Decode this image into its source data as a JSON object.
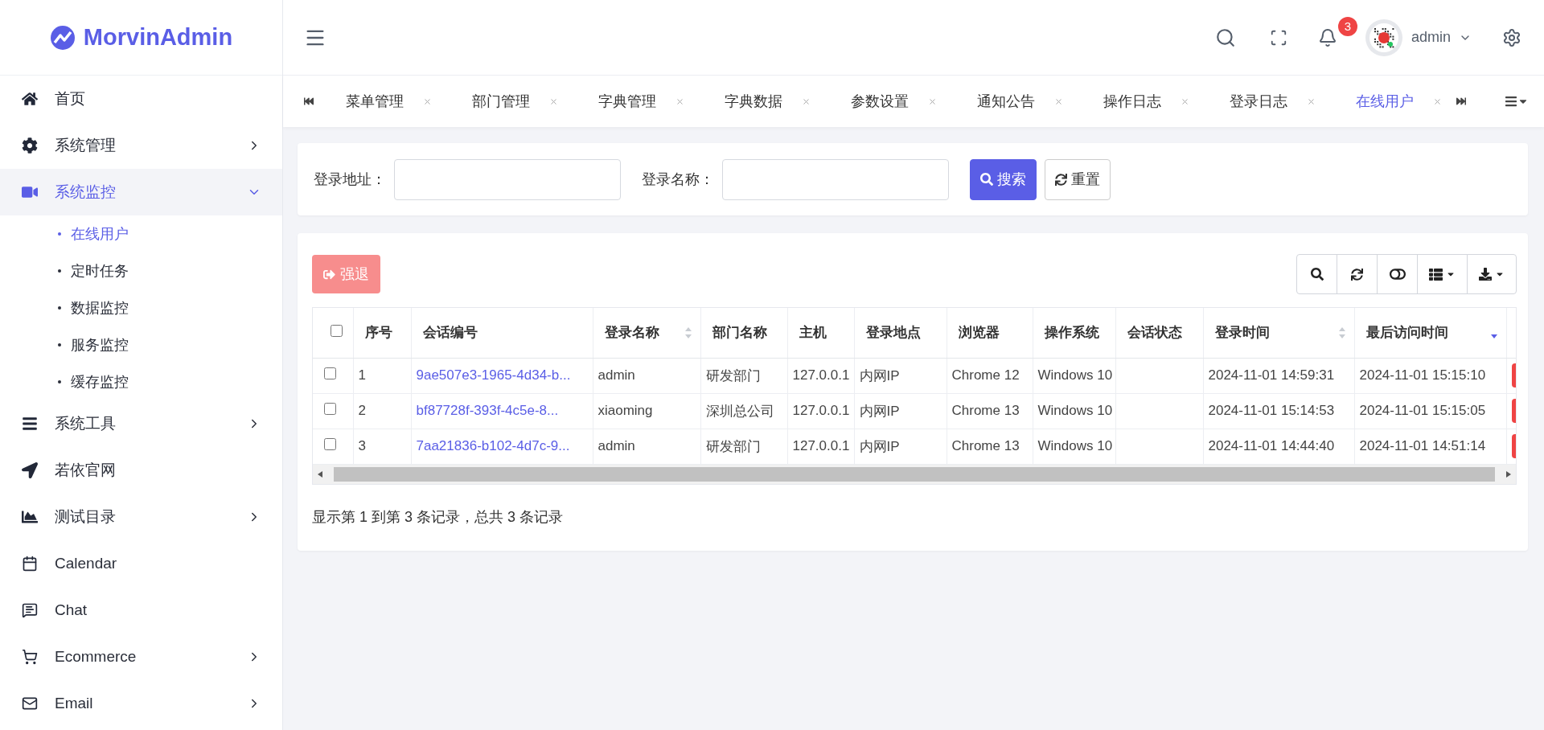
{
  "brand": {
    "name": "MorvinAdmin"
  },
  "sidebar": {
    "items": [
      {
        "label": "首页",
        "kind": "link",
        "selected": false
      },
      {
        "label": "系统管理",
        "kind": "menu",
        "selected": false,
        "expanded": false
      },
      {
        "label": "系统监控",
        "kind": "menu",
        "selected": true,
        "expanded": true,
        "children": [
          {
            "label": "在线用户",
            "selected": true
          },
          {
            "label": "定时任务",
            "selected": false
          },
          {
            "label": "数据监控",
            "selected": false
          },
          {
            "label": "服务监控",
            "selected": false
          },
          {
            "label": "缓存监控",
            "selected": false
          }
        ]
      },
      {
        "label": "系统工具",
        "kind": "menu",
        "selected": false,
        "expanded": false
      },
      {
        "label": "若依官网",
        "kind": "link",
        "selected": false
      },
      {
        "label": "测试目录",
        "kind": "menu",
        "selected": false,
        "expanded": false
      },
      {
        "label": "Calendar",
        "kind": "link",
        "selected": false
      },
      {
        "label": "Chat",
        "kind": "link",
        "selected": false
      },
      {
        "label": "Ecommerce",
        "kind": "menu",
        "selected": false,
        "expanded": false
      },
      {
        "label": "Email",
        "kind": "menu",
        "selected": false,
        "expanded": false
      }
    ]
  },
  "header": {
    "notification_count": "3",
    "user": "admin"
  },
  "tabs": [
    {
      "label": "菜单管理",
      "selected": false
    },
    {
      "label": "部门管理",
      "selected": false
    },
    {
      "label": "字典管理",
      "selected": false
    },
    {
      "label": "字典数据",
      "selected": false
    },
    {
      "label": "参数设置",
      "selected": false
    },
    {
      "label": "通知公告",
      "selected": false
    },
    {
      "label": "操作日志",
      "selected": false
    },
    {
      "label": "登录日志",
      "selected": false
    },
    {
      "label": "在线用户",
      "selected": true
    }
  ],
  "search_form": {
    "fields": [
      {
        "label": "登录地址："
      },
      {
        "label": "登录名称："
      }
    ],
    "search_button": "搜索",
    "reset_button": "重置"
  },
  "toolbar": {
    "force_logout_button": {
      "label": "强退",
      "disabled": true
    }
  },
  "table": {
    "columns": [
      {
        "label": "序号"
      },
      {
        "label": "会话编号"
      },
      {
        "label": "登录名称",
        "sortable": true,
        "sorted": false
      },
      {
        "label": "部门名称"
      },
      {
        "label": "主机"
      },
      {
        "label": "登录地点"
      },
      {
        "label": "浏览器"
      },
      {
        "label": "操作系统"
      },
      {
        "label": "会话状态"
      },
      {
        "label": "登录时间",
        "sortable": true,
        "sorted": false
      },
      {
        "label": "最后访问时间",
        "sortable": true,
        "sorted": true
      }
    ],
    "all_checked": false,
    "rows": [
      {
        "checked": false,
        "cells": [
          "1",
          "9ae507e3-1965-4d34-b...",
          "admin",
          "研发部门",
          "127.0.0.1",
          "内网IP",
          "Chrome 12",
          "Windows 10",
          "",
          "2024-11-01 14:59:31",
          "2024-11-01 15:15:10"
        ]
      },
      {
        "checked": false,
        "cells": [
          "2",
          "bf87728f-393f-4c5e-8...",
          "xiaoming",
          "深圳总公司",
          "127.0.0.1",
          "内网IP",
          "Chrome 13",
          "Windows 10",
          "",
          "2024-11-01 15:14:53",
          "2024-11-01 15:15:05"
        ]
      },
      {
        "checked": false,
        "cells": [
          "3",
          "7aa21836-b102-4d7c-9...",
          "admin",
          "研发部门",
          "127.0.0.1",
          "内网IP",
          "Chrome 13",
          "Windows 10",
          "",
          "2024-11-01 14:44:40",
          "2024-11-01 14:51:14"
        ]
      }
    ]
  },
  "pagination_info": "显示第 1 到第 3 条记录，总共 3 条记录"
}
